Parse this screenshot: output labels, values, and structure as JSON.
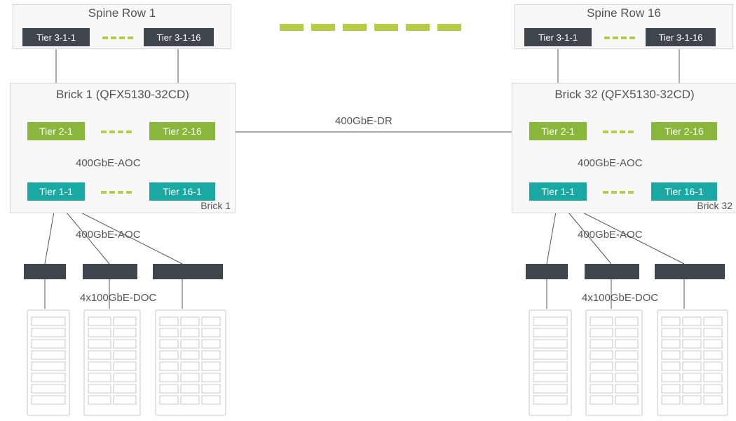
{
  "spine_left": {
    "title": "Spine Row 1",
    "tier_a": "Tier 3-1-1",
    "tier_b": "Tier 3-1-16"
  },
  "spine_right": {
    "title": "Spine Row 16",
    "tier_a": "Tier 3-1-1",
    "tier_b": "Tier 3-1-16"
  },
  "brick_left": {
    "title": "Brick 1 (QFX5130-32CD)",
    "t2a": "Tier 2-1",
    "t2b": "Tier 2-16",
    "t1a": "Tier 1-1",
    "t1b": "Tier 16-1",
    "tag": "Brick 1",
    "aoc_inner": "400GbE-AOC"
  },
  "brick_right": {
    "title": "Brick 32 (QFX5130-32CD)",
    "t2a": "Tier 2-1",
    "t2b": "Tier 2-16",
    "t1a": "Tier 1-1",
    "t1b": "Tier 16-1",
    "tag": "Brick 32",
    "aoc_inner": "400GbE-AOC"
  },
  "link_dr": "400GbE-DR",
  "leaf_left": {
    "aoc": "400GbE-AOC",
    "doc": "4x100GbE-DOC"
  },
  "leaf_right": {
    "aoc": "400GbE-AOC",
    "doc": "4x100GbE-DOC"
  }
}
